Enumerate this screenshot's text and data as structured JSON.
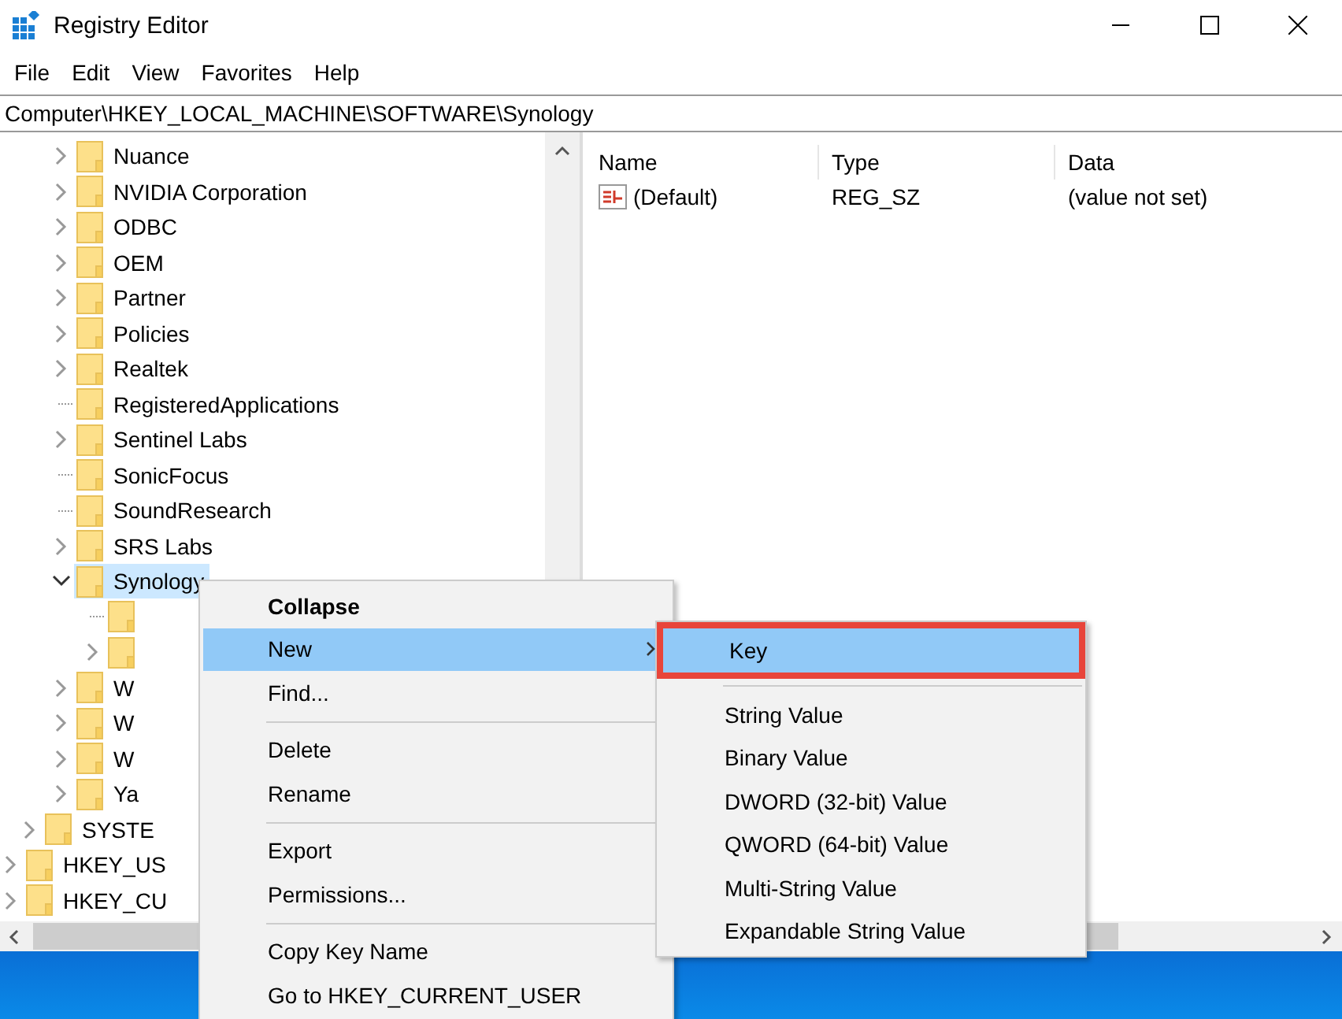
{
  "window": {
    "title": "Registry Editor"
  },
  "menu_bar": [
    "File",
    "Edit",
    "View",
    "Favorites",
    "Help"
  ],
  "address_bar": {
    "value": "Computer\\HKEY_LOCAL_MACHINE\\SOFTWARE\\Synology"
  },
  "tree": [
    {
      "kind": "scrolled_out",
      "children": [
        {
          "kind": "scrolled_out",
          "children": [
            {
              "kind": "key",
              "label": "Nuance",
              "expandable": true,
              "expanded": false,
              "selected": false
            },
            {
              "kind": "key",
              "label": "NVIDIA Corporation",
              "expandable": true,
              "expanded": false,
              "selected": false
            },
            {
              "kind": "key",
              "label": "ODBC",
              "expandable": true,
              "expanded": false,
              "selected": false
            },
            {
              "kind": "key",
              "label": "OEM",
              "expandable": true,
              "expanded": false,
              "selected": false
            },
            {
              "kind": "key",
              "label": "Partner",
              "expandable": true,
              "expanded": false,
              "selected": false
            },
            {
              "kind": "key",
              "label": "Policies",
              "expandable": true,
              "expanded": false,
              "selected": false
            },
            {
              "kind": "key",
              "label": "Realtek",
              "expandable": true,
              "expanded": false,
              "selected": false
            },
            {
              "kind": "key",
              "label": "RegisteredApplications",
              "expandable": false,
              "selected": false
            },
            {
              "kind": "key",
              "label": "Sentinel Labs",
              "expandable": true,
              "expanded": false,
              "selected": false
            },
            {
              "kind": "key",
              "label": "SonicFocus",
              "expandable": false,
              "selected": false
            },
            {
              "kind": "key",
              "label": "SoundResearch",
              "expandable": false,
              "selected": false
            },
            {
              "kind": "key",
              "label": "SRS Labs",
              "expandable": true,
              "expanded": false,
              "selected": false
            },
            {
              "kind": "key",
              "label": "Synology",
              "expandable": true,
              "expanded": true,
              "selected": true,
              "children": [
                {
                  "kind": "key",
                  "expandable": false,
                  "selected": false
                },
                {
                  "kind": "key",
                  "expandable": true,
                  "expanded": false,
                  "selected": false
                }
              ]
            },
            {
              "kind": "key",
              "label": "W",
              "expandable": true,
              "expanded": false,
              "selected": false
            },
            {
              "kind": "key",
              "label": "W",
              "expandable": true,
              "expanded": false,
              "selected": false
            },
            {
              "kind": "key",
              "label": "W",
              "expandable": true,
              "expanded": false,
              "selected": false
            },
            {
              "kind": "key",
              "label": "Ya",
              "expandable": true,
              "expanded": false,
              "selected": false
            }
          ]
        },
        {
          "kind": "key",
          "label": "SYSTE",
          "expandable": true,
          "expanded": false,
          "selected": false
        }
      ]
    },
    {
      "kind": "key",
      "label": "HKEY_US",
      "expandable": true,
      "expanded": false,
      "selected": false
    },
    {
      "kind": "key",
      "label": "HKEY_CU",
      "expandable": true,
      "expanded": false,
      "selected": false
    }
  ],
  "values_list": {
    "columns": [
      "Name",
      "Type",
      "Data"
    ],
    "rows": [
      {
        "name": "(Default)",
        "type": "REG_SZ",
        "data": "(value not set)"
      }
    ]
  },
  "context_menu": [
    {
      "kind": "item",
      "label": "Collapse",
      "default": true,
      "selected": false
    },
    {
      "kind": "submenu",
      "label": "New",
      "default": false,
      "selected": true
    },
    {
      "kind": "item",
      "label": "Find...",
      "default": false,
      "selected": false
    },
    {
      "kind": "separator"
    },
    {
      "kind": "item",
      "label": "Delete",
      "default": false,
      "selected": false
    },
    {
      "kind": "item",
      "label": "Rename",
      "default": false,
      "selected": false
    },
    {
      "kind": "separator"
    },
    {
      "kind": "item",
      "label": "Export",
      "default": false,
      "selected": false
    },
    {
      "kind": "item",
      "label": "Permissions...",
      "default": false,
      "selected": false
    },
    {
      "kind": "separator"
    },
    {
      "kind": "item",
      "label": "Copy Key Name",
      "default": false,
      "selected": false
    },
    {
      "kind": "item",
      "label": "Go to HKEY_CURRENT_USER",
      "default": false,
      "selected": false
    }
  ],
  "new_submenu": [
    {
      "kind": "item",
      "label": "Key",
      "selected": true,
      "outlined": true
    },
    {
      "kind": "separator"
    },
    {
      "kind": "item",
      "label": "String Value",
      "selected": false,
      "outlined": false
    },
    {
      "kind": "item",
      "label": "Binary Value",
      "selected": false,
      "outlined": false
    },
    {
      "kind": "item",
      "label": "DWORD (32-bit) Value",
      "selected": false,
      "outlined": false
    },
    {
      "kind": "item",
      "label": "QWORD (64-bit) Value",
      "selected": false,
      "outlined": false
    },
    {
      "kind": "item",
      "label": "Multi-String Value",
      "selected": false,
      "outlined": false
    },
    {
      "kind": "item",
      "label": "Expandable String Value",
      "selected": false,
      "outlined": false
    }
  ]
}
